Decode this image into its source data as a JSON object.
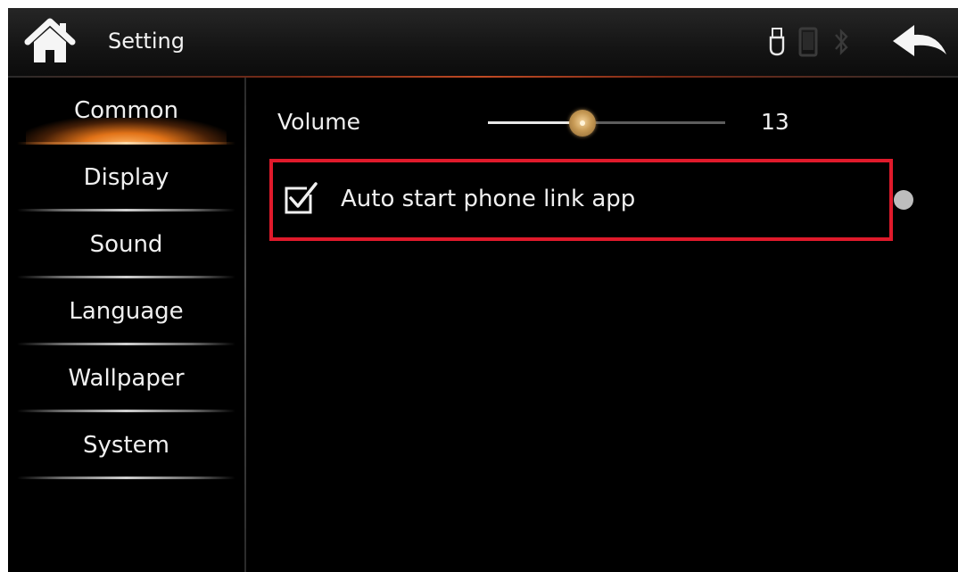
{
  "header": {
    "title": "Setting",
    "home_icon": "home-icon",
    "status_icons": [
      "usb-icon",
      "phone-icon",
      "bluetooth-icon"
    ],
    "back_icon": "back-arrow-icon"
  },
  "sidebar": {
    "items": [
      {
        "label": "Common",
        "active": true
      },
      {
        "label": "Display",
        "active": false
      },
      {
        "label": "Sound",
        "active": false
      },
      {
        "label": "Language",
        "active": false
      },
      {
        "label": "Wallpaper",
        "active": false
      },
      {
        "label": "System",
        "active": false
      }
    ]
  },
  "main": {
    "volume": {
      "label": "Volume",
      "value": "13",
      "level_fraction": 0.4
    },
    "auto_start": {
      "label": "Auto start phone link app",
      "checked": true
    }
  },
  "colors": {
    "highlight_border": "#e01a2b",
    "active_glow": "#e27318",
    "background": "#000000"
  }
}
